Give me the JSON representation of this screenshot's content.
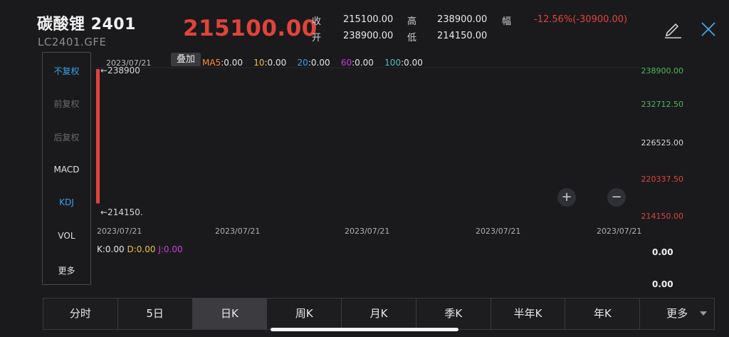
{
  "header": {
    "name": "碳酸锂 2401",
    "code": "LC2401.GFE",
    "last_price": "215100.00",
    "quote": {
      "close_label": "收",
      "close_value": "215100.00",
      "open_label": "开",
      "open_value": "238900.00",
      "high_label": "高",
      "high_value": "238900.00",
      "low_label": "低",
      "low_value": "214150.00",
      "change_label": "幅",
      "change_value": "-12.56%(-30900.00)"
    }
  },
  "side_menu": {
    "items": [
      "不复权",
      "前复权",
      "后复权",
      "MACD",
      "KDJ",
      "VOL",
      "更多"
    ],
    "active": [
      "不复权",
      "KDJ"
    ]
  },
  "chart": {
    "overlay_label": "叠加",
    "top_date": "2023/07/21",
    "ma": [
      {
        "label": "MA5",
        "value": ":0.00",
        "color": "#ff8c2e"
      },
      {
        "label": "10",
        "value": ":0.00",
        "color": "#e8c336"
      },
      {
        "label": "20",
        "value": ":0.00",
        "color": "#3c9be6"
      },
      {
        "label": "60",
        "value": ":0.00",
        "color": "#c83cd8"
      },
      {
        "label": "100",
        "value": ":0.00",
        "color": "#46c2c2"
      }
    ],
    "high_annotation": "←238900",
    "low_annotation": "←214150.",
    "y_labels": [
      "238900.00",
      "232712.50",
      "226525.00",
      "220337.50",
      "214150.00"
    ],
    "x_labels": [
      "2023/07/21",
      "2023/07/21",
      "2023/07/21",
      "2023/07/21",
      "2023/07/21"
    ],
    "zoom_in": "+",
    "zoom_out": "−",
    "kdj": {
      "k": "K:0.00",
      "d": "D:0.00",
      "j": "J:0.00"
    },
    "indicator_values": [
      "0.00",
      "0.00"
    ]
  },
  "chart_data": {
    "type": "candlestick",
    "x": [
      "2023/07/21"
    ],
    "open": [
      238900.0
    ],
    "high": [
      238900.0
    ],
    "low": [
      214150.0
    ],
    "close": [
      215100.0
    ],
    "ylim": [
      214150.0,
      238900.0
    ]
  },
  "tabs": [
    "分时",
    "5日",
    "日K",
    "周K",
    "月K",
    "季K",
    "半年K",
    "年K",
    "更多"
  ],
  "active_tab": "日K",
  "colors": {
    "up": "#e0443a",
    "accent": "#3ca0e6",
    "background": "#1a1a1d"
  }
}
